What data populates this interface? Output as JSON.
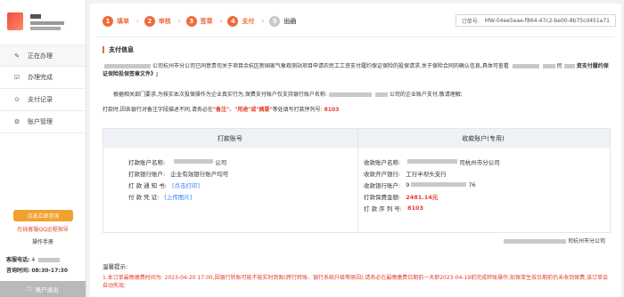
{
  "sidebar": {
    "nav": [
      {
        "icon": "pencil-icon",
        "glyph": "✎",
        "label": "正在办理"
      },
      {
        "icon": "check-circle-icon",
        "glyph": "☑",
        "label": "办理完成"
      },
      {
        "icon": "record-icon",
        "glyph": "⊙",
        "label": "支付记录"
      },
      {
        "icon": "gear-icon",
        "glyph": "⚙",
        "label": "账户管理"
      }
    ],
    "help_button": "点击立即咨询",
    "help_link": "在线客服QQ远程指导",
    "manual": "操作手册",
    "phone_label": "客服电话:",
    "phone_value": "4",
    "hours_label": "咨询时间:",
    "hours_value": "08:30-17:30",
    "logout": "账户退出"
  },
  "steps": [
    {
      "num": "1",
      "label": "填单",
      "active": true
    },
    {
      "num": "2",
      "label": "审核",
      "active": true
    },
    {
      "num": "3",
      "label": "签章",
      "active": true
    },
    {
      "num": "4",
      "label": "支付",
      "active": true
    },
    {
      "num": "5",
      "label": "出函",
      "active": false
    }
  ],
  "order": {
    "label": "订单号:",
    "value": "MW-04ee5eae-f864-47c2-be00-8b75cd451a71"
  },
  "payment": {
    "title": "支付信息",
    "p1_a": "公司杭州市分公司已同意贵司关于项目余杭区新国家气象观测站项目申请农民工工资支付履约保证保险的投保请求,关于保险合同的确认信息,具体可查看",
    "p1_b": "民",
    "p1_c": "资支付履约保证保险投保签章文件》;",
    "p2_a": "根据相关部门要求,为核实本次投保操作为企业真实行为,保费支付账户仅支持银行账户名称:",
    "p2_b": "公司的企业账户支付,敬请理解;",
    "p3_a": "打款时,因各银行对备注字段描述不同,请务必在",
    "p3_note1": "\"备注\"",
    "p3_mid": "、",
    "p3_note2": "\"用途\"或\"摘要\"",
    "p3_b": "等处填写打款序列号:",
    "p3_serial": "8103"
  },
  "table": {
    "head_left": "打款账号",
    "head_right": "收款账户(专用)",
    "left_rows": [
      {
        "k": "打款账户名称:",
        "v": "公司",
        "type": "text"
      },
      {
        "k": "打款银行账户:",
        "v": "企业有效银行账户均可",
        "type": "text"
      },
      {
        "k": "打 款 通 知 书:",
        "v": "[点击打印]",
        "type": "link"
      },
      {
        "k": "付  款  凭  证:",
        "v": "[上传图片]",
        "type": "link"
      }
    ],
    "right_rows": [
      {
        "k": "收款账户名称:",
        "v": "司杭州市分公司",
        "type": "text"
      },
      {
        "k": "收款开户银行:",
        "v": "工行半坝头支行",
        "type": "text"
      },
      {
        "k": "收款银行账户:",
        "v": "76",
        "type": "text"
      },
      {
        "k": "打款保费金额:",
        "v": "2481.14元",
        "type": "amount"
      },
      {
        "k": "打  款  序  列  号:",
        "v": "8103",
        "type": "amount"
      }
    ]
  },
  "signature": "司杭州市分公司",
  "tips": {
    "title": "温馨提示:",
    "line": "1.本订单最晚缴费时间为: 2023-04-20 17:00,因银行转账可能不能实时到账(跨行转账、银行系统升级等原因),请务必在最晚缴费日期前一天即2023-04-19前完成转账操作;如保单生效日期前仍未收到保费,该订单会自动失效;"
  }
}
